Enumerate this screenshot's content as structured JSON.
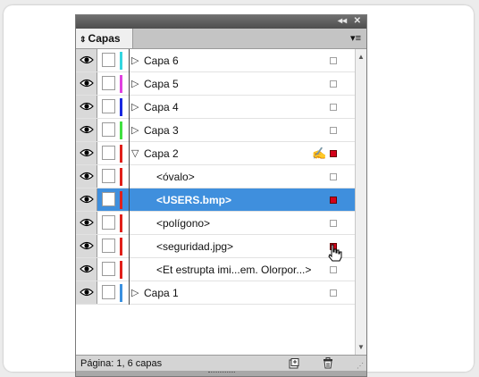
{
  "panel": {
    "collapse_glyph": "◂◂",
    "close_glyph": "✕",
    "tab_arrows": "⇕",
    "tab_label": "Capas",
    "menu_glyph": "▾≡"
  },
  "layers": [
    {
      "label": "Capa 6",
      "expander": "▷",
      "color": "#33d6e0",
      "indent": 0,
      "selected": false,
      "marker": "empty"
    },
    {
      "label": "Capa 5",
      "expander": "▷",
      "color": "#e040e0",
      "indent": 0,
      "selected": false,
      "marker": "empty"
    },
    {
      "label": "Capa 4",
      "expander": "▷",
      "color": "#1a28e0",
      "indent": 0,
      "selected": false,
      "marker": "empty"
    },
    {
      "label": "Capa 3",
      "expander": "▷",
      "color": "#40e040",
      "indent": 0,
      "selected": false,
      "marker": "empty"
    },
    {
      "label": "Capa 2",
      "expander": "▽",
      "color": "#e0201a",
      "indent": 0,
      "selected": false,
      "marker": "filled",
      "pen": true
    },
    {
      "label": "<óvalo>",
      "expander": "",
      "color": "#e0201a",
      "indent": 1,
      "selected": false,
      "marker": "empty"
    },
    {
      "label": "<USERS.bmp>",
      "expander": "",
      "color": "#e0201a",
      "indent": 1,
      "selected": true,
      "marker": "filled"
    },
    {
      "label": "<polígono>",
      "expander": "",
      "color": "#e0201a",
      "indent": 1,
      "selected": false,
      "marker": "empty"
    },
    {
      "label": "<seguridad.jpg>",
      "expander": "",
      "color": "#e0201a",
      "indent": 1,
      "selected": false,
      "marker": "filled",
      "cursor": true
    },
    {
      "label": "<Et estrupta imi...em. Olorpor...>",
      "expander": "",
      "color": "#e0201a",
      "indent": 1,
      "selected": false,
      "marker": "empty"
    },
    {
      "label": "Capa 1",
      "expander": "▷",
      "color": "#3a90e0",
      "indent": 0,
      "selected": false,
      "marker": "empty"
    }
  ],
  "scroll": {
    "up": "▲",
    "down": "▼"
  },
  "footer": {
    "status": "Página: 1, 6 capas",
    "grip": "⋰"
  },
  "colors": {
    "selection": "#3f8fdd",
    "marker_red": "#d4001a"
  }
}
